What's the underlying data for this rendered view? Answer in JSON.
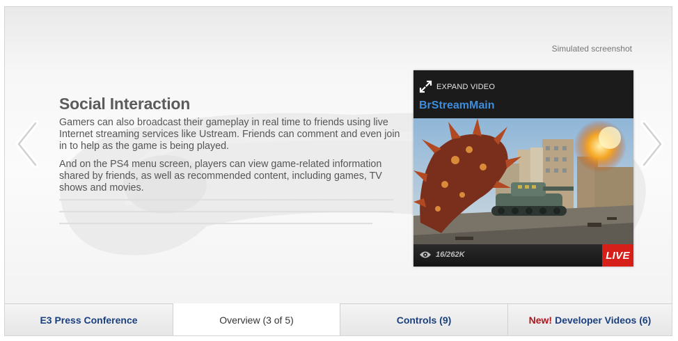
{
  "caption": "Simulated screenshot",
  "feature": {
    "title": "Social Interaction",
    "paragraphs": [
      "Gamers can also broadcast their gameplay in real time to friends using live Internet streaming services like Ustream. Friends can comment and even join in to help as the game is being played.",
      "And on the PS4 menu screen, players can view game-related information shared by friends, as well as recommended content, including games, TV shows and movies."
    ]
  },
  "player": {
    "expand_label": "EXPAND VIDEO",
    "stream_name": "BrStreamMain",
    "viewers": "16/262K",
    "live_label": "LIVE"
  },
  "tabs": [
    {
      "label": "E3 Press Conference",
      "active": false
    },
    {
      "label": "Overview (3 of 5)",
      "active": true
    },
    {
      "label": "Controls (9)",
      "active": false
    },
    {
      "prefix": "New!",
      "label": "Developer Videos (6)",
      "active": false
    }
  ],
  "icons": {
    "prev": "chevron-left-icon",
    "next": "chevron-right-icon",
    "expand": "expand-arrows-icon",
    "viewers": "eye-icon"
  },
  "colors": {
    "stream_name": "#3d8ddc",
    "live_badge": "#d71f1a",
    "tab_text": "#1a3f7f",
    "new_flag": "#b0141c"
  }
}
